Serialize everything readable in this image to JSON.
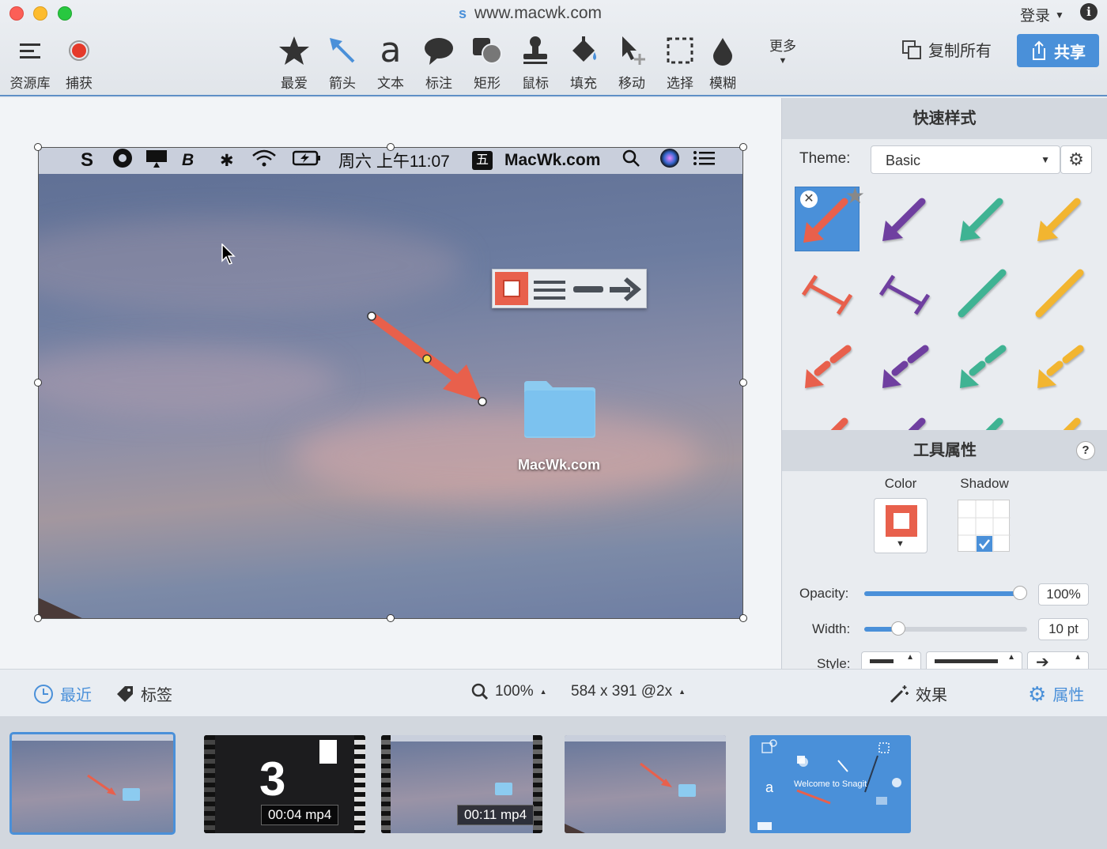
{
  "window": {
    "url": "www.macwk.com",
    "login_label": "登录"
  },
  "toolbar": {
    "left": [
      {
        "label": "资源库",
        "icon": "hamburger-icon"
      },
      {
        "label": "捕获",
        "icon": "record-icon"
      }
    ],
    "tools": [
      {
        "label": "最爱",
        "icon": "star-icon"
      },
      {
        "label": "箭头",
        "icon": "arrow-tool-icon"
      },
      {
        "label": "文本",
        "icon": "text-tool-icon"
      },
      {
        "label": "标注",
        "icon": "callout-icon"
      },
      {
        "label": "矩形",
        "icon": "shape-icon"
      },
      {
        "label": "鼠标",
        "icon": "stamp-icon"
      },
      {
        "label": "填充",
        "icon": "fill-icon"
      },
      {
        "label": "移动",
        "icon": "move-icon"
      },
      {
        "label": "选择",
        "icon": "selection-icon"
      },
      {
        "label": "模糊",
        "icon": "blur-icon"
      }
    ],
    "more_label": "更多",
    "copy_all_label": "复制所有",
    "share_label": "共享"
  },
  "capture": {
    "menubar_time": "周六 上午11:07",
    "menubar_site": "MacWk.com",
    "ime_glyph": "五",
    "folder_label": "MacWk.com"
  },
  "panel": {
    "quick_styles_title": "快速样式",
    "theme_label": "Theme:",
    "theme_value": "Basic",
    "tool_props_title": "工具属性",
    "color_label": "Color",
    "shadow_label": "Shadow",
    "opacity_label": "Opacity:",
    "opacity_value": "100%",
    "opacity_level": 1.0,
    "width_label": "Width:",
    "width_value": "10 pt",
    "style_label": "Style:",
    "help_glyph": "?"
  },
  "bottombar": {
    "recent_label": "最近",
    "tags_label": "标签",
    "zoom_value": "100%",
    "dimensions": "584 x 391 @2x",
    "effects_label": "效果",
    "properties_label": "属性"
  },
  "tray": {
    "video1_count": "3",
    "video1_caption": "00:04 mp4",
    "video2_caption": "00:11 mp4",
    "welcome_text": "Welcome to Snagit",
    "welcome_letter": "a"
  },
  "colors": {
    "accent": "#4a90d9",
    "arrow_red": "#e8604c",
    "purple": "#6f3fa0",
    "teal": "#3fb393",
    "yellow": "#f2b530"
  }
}
